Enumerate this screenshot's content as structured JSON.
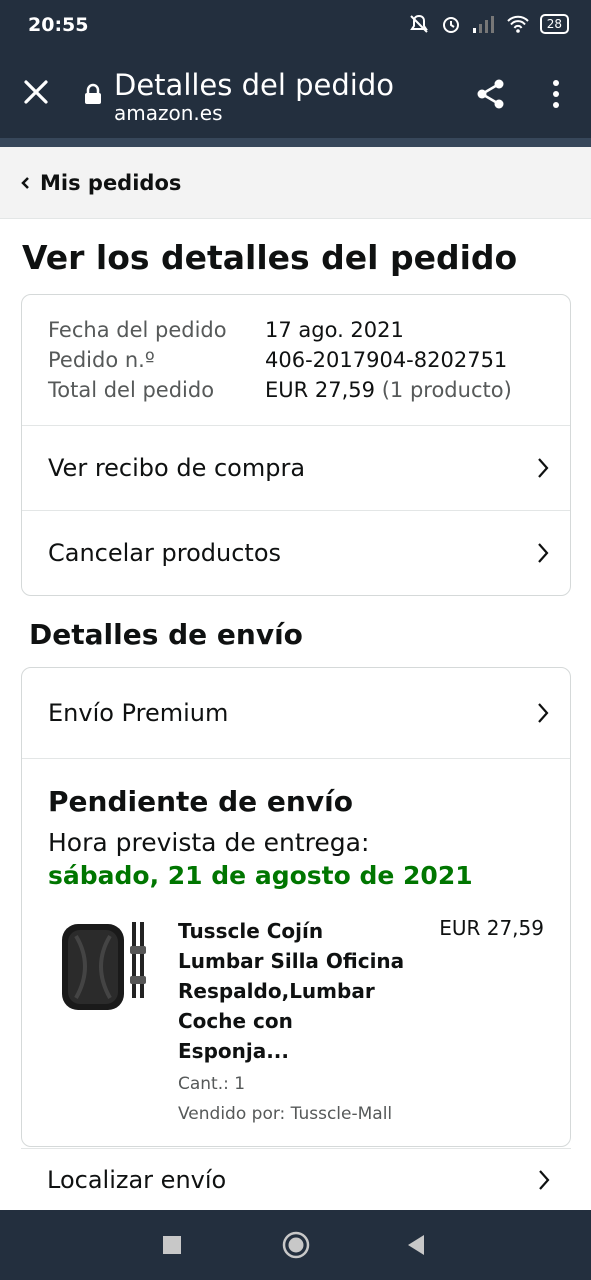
{
  "status_bar": {
    "time": "20:55",
    "battery": "28"
  },
  "browser": {
    "title": "Detalles del pedido",
    "url": "amazon.es"
  },
  "breadcrumb": {
    "label": "Mis pedidos"
  },
  "page": {
    "title": "Ver los detalles del pedido"
  },
  "summary": {
    "rows": [
      {
        "label": "Fecha del pedido",
        "value": "17 ago. 2021",
        "extra": ""
      },
      {
        "label": "Pedido n.º",
        "value": "406-2017904-8202751",
        "extra": ""
      },
      {
        "label": "Total del pedido",
        "value": "EUR 27,59",
        "extra": "(1 producto)"
      }
    ],
    "receipt_label": "Ver recibo de compra",
    "cancel_label": "Cancelar productos"
  },
  "shipping": {
    "heading": "Detalles de envío",
    "method": "Envío Premium",
    "status": "Pendiente de envío",
    "eta_label": "Hora prevista de entrega:",
    "eta_date": "sábado, 21 de agosto de 2021",
    "item": {
      "name": "Tusscle Cojín Lumbar Silla Oficina Respaldo,Lumbar Coche con Esponja...",
      "price": "EUR 27,59",
      "qty": "Cant.: 1",
      "seller": "Vendido por: Tusscle-Mall"
    },
    "track_label": "Localizar envío"
  },
  "colors": {
    "header": "#232f3e",
    "delivery_green": "#007600",
    "crumb_bg": "#f3f3f3"
  }
}
